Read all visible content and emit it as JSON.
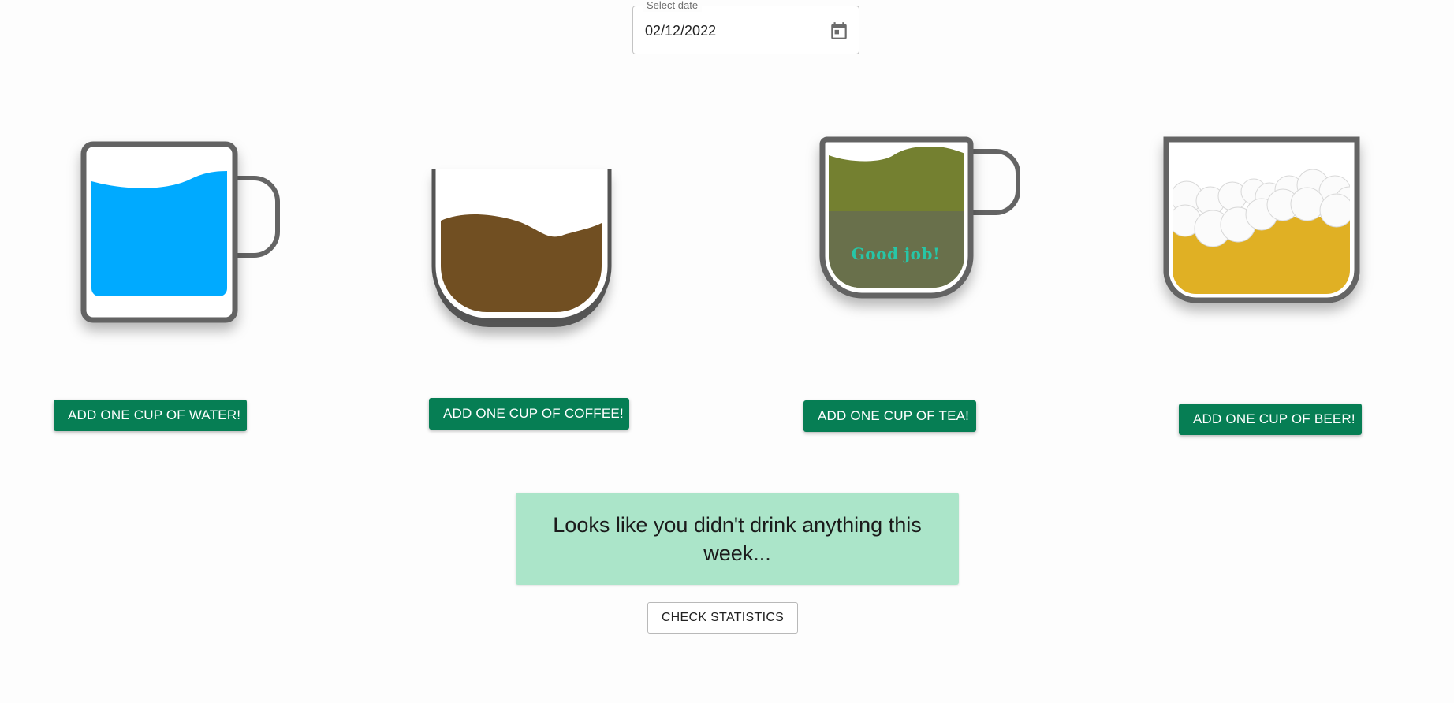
{
  "date_picker": {
    "label": "Select date",
    "value": "02/12/2022",
    "icon": "calendar-icon"
  },
  "cups": [
    {
      "drink": "water",
      "button_label": "ADD ONE CUP OF WATER!",
      "fill_color": "#00aaff"
    },
    {
      "drink": "coffee",
      "button_label": "ADD ONE CUP OF COFFEE!",
      "fill_color": "#714f22"
    },
    {
      "drink": "tea",
      "button_label": "ADD ONE CUP OF TEA!",
      "fill_color": "#748030",
      "overlay_text": "Good job!"
    },
    {
      "drink": "beer",
      "button_label": "ADD ONE CUP OF BEER!",
      "fill_color": "#e0b024"
    }
  ],
  "message": "Looks like you didn't drink anything this week...",
  "stats_button": "CHECK STATISTICS",
  "colors": {
    "button_green": "#067e54",
    "message_bg": "#abe5c9",
    "cup_border": "#646464"
  }
}
